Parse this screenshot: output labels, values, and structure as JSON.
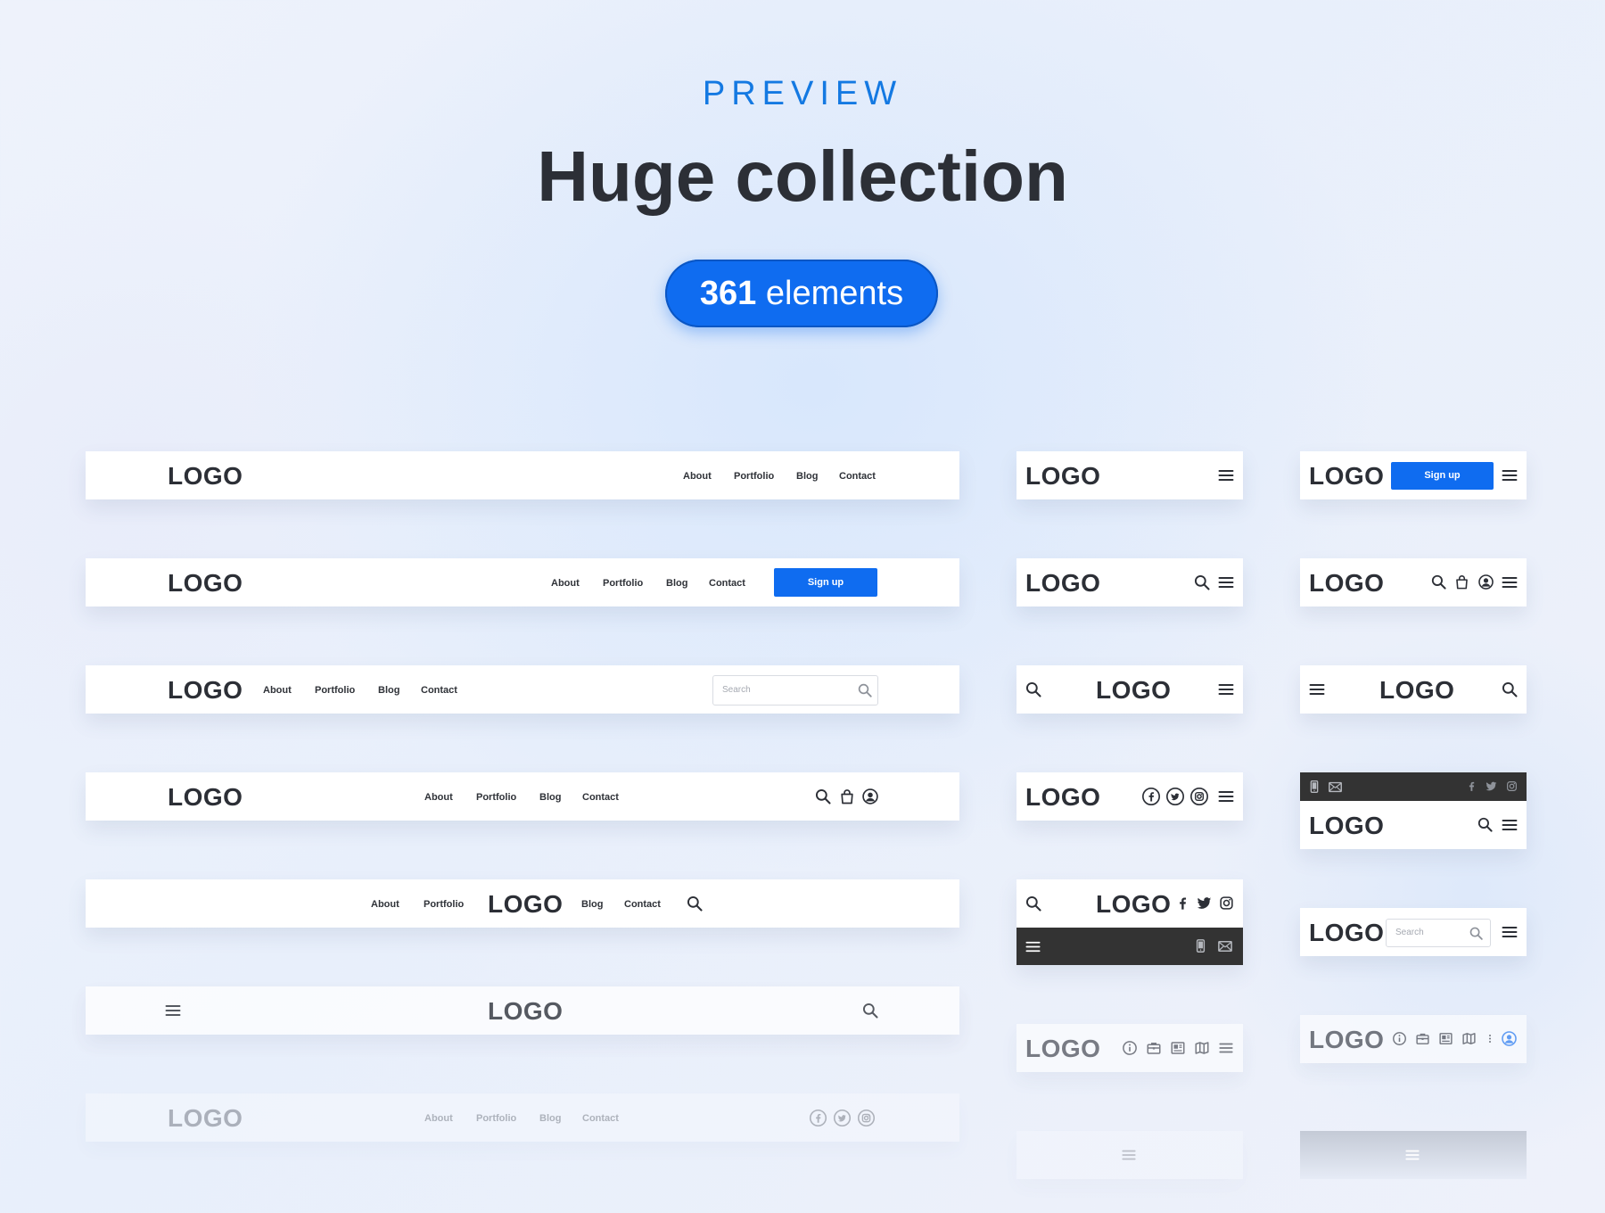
{
  "header": {
    "eyebrow": "PREVIEW",
    "title": "Huge collection",
    "badge_number": "361",
    "badge_label": "elements"
  },
  "navbars": {
    "logo": "LOGO",
    "links": [
      "About",
      "Portfolio",
      "Blog",
      "Contact"
    ],
    "signup_label": "Sign up",
    "search_placeholder": "Search"
  },
  "colors": {
    "accent": "#0f6cf0",
    "eyebrow": "#1479e2",
    "text": "#2c2f36",
    "dark_bar": "#333333"
  }
}
